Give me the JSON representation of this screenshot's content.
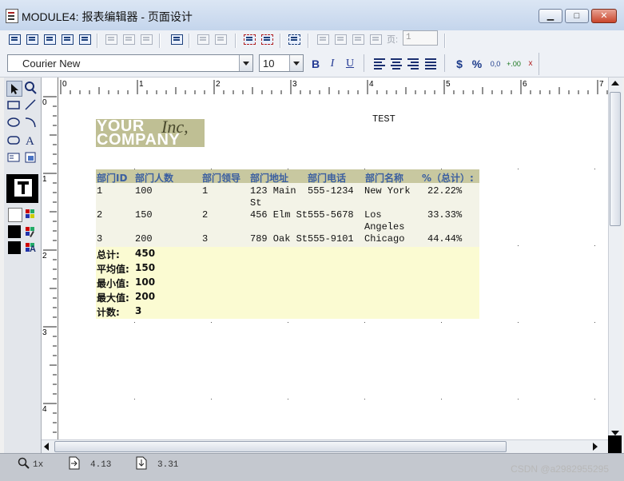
{
  "window": {
    "title": "MODULE4: 报表编辑器 - 页面设计",
    "minimize": "▁",
    "maximize": "□",
    "close": "✕"
  },
  "toolbar": {
    "page_label": "页:",
    "page_value": "1"
  },
  "format_bar": {
    "font_name": "Courier New",
    "font_size": "10",
    "bold": "B",
    "italic": "I",
    "underline": "U",
    "currency": "$",
    "percent": "%",
    "decimals_inc": "0,0",
    "decimals_add": "+.00",
    "decimals_remove": "x"
  },
  "ruler": {
    "h_labels": [
      "0",
      "1",
      "2",
      "3",
      "4",
      "5",
      "6",
      "7"
    ],
    "v_labels": [
      "0",
      "1",
      "2",
      "3",
      "4"
    ]
  },
  "report": {
    "title": "TEST",
    "logo": {
      "line1": "YOUR",
      "line1_italic": "Inc,",
      "line2": "COMPANY"
    },
    "columns": [
      "部门ID",
      "部门人数",
      "部门领导",
      "部门地址",
      "部门电话",
      "部门名称",
      "%（总计）:"
    ],
    "rows": [
      {
        "id": "1",
        "count": "100",
        "leader": "1",
        "address": [
          "123 Main",
          "St"
        ],
        "phone": "555-1234",
        "name": [
          "New York"
        ],
        "percent": "22.22%"
      },
      {
        "id": "2",
        "count": "150",
        "leader": "2",
        "address": [
          "456 Elm St"
        ],
        "phone": "555-5678",
        "name": [
          "Los",
          "Angeles"
        ],
        "percent": "33.33%"
      },
      {
        "id": "3",
        "count": "200",
        "leader": "3",
        "address": [
          "789 Oak St"
        ],
        "phone": "555-9101",
        "name": [
          "Chicago"
        ],
        "percent": "44.44%"
      }
    ],
    "summary": [
      {
        "label": "总计:",
        "value": "450"
      },
      {
        "label": "平均值:",
        "value": "150"
      },
      {
        "label": "最小值:",
        "value": "100"
      },
      {
        "label": "最大值:",
        "value": "200"
      },
      {
        "label": "计数:",
        "value": "3"
      }
    ]
  },
  "status": {
    "zoom": "1x",
    "pos_x": "4.13",
    "pos_y": "3.31"
  },
  "watermark": "CSDN @a2982955295"
}
